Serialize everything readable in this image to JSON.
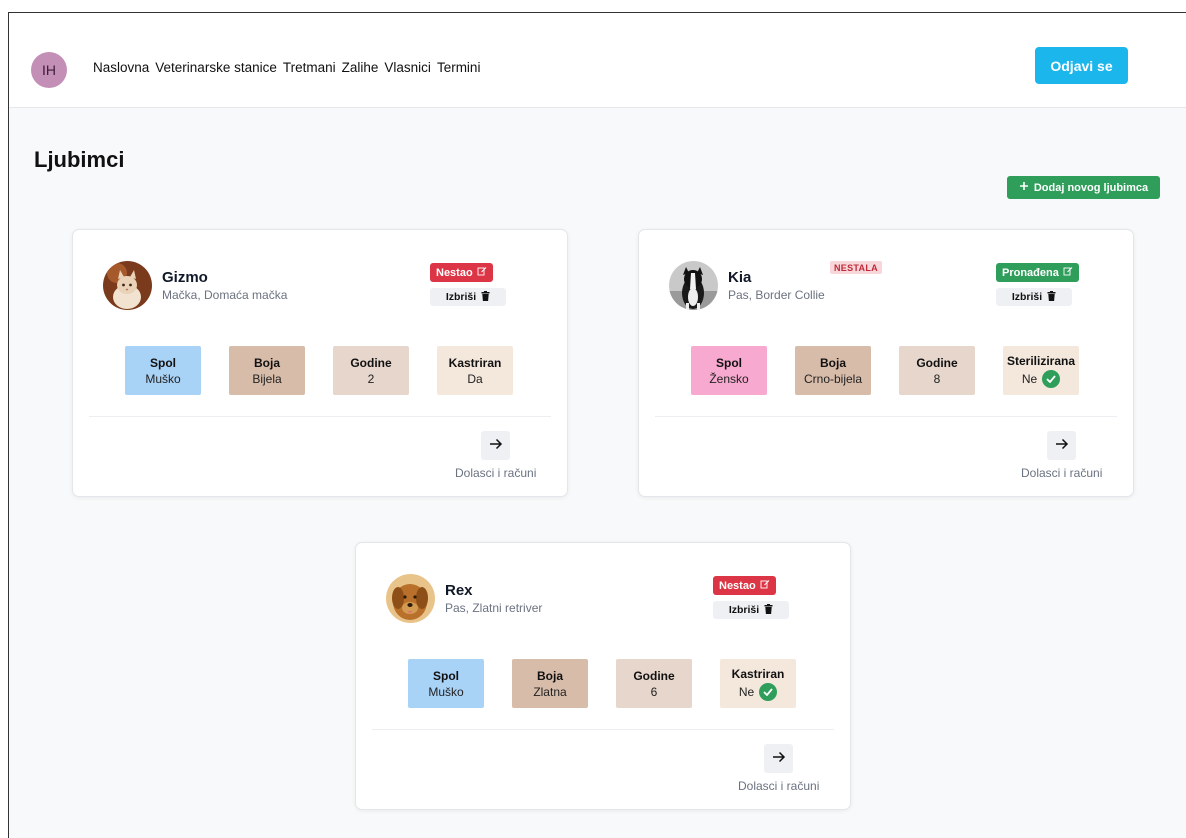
{
  "header": {
    "avatar_initials": "IH",
    "nav": [
      "Naslovna",
      "Veterinarske stanice",
      "Tretmani",
      "Zalihe",
      "Vlasnici",
      "Termini"
    ],
    "logout_label": "Odjavi se"
  },
  "page": {
    "title": "Ljubimci",
    "add_label": "Dodaj novog ljubimca"
  },
  "visits_label": "Dolasci i računi",
  "pets": [
    {
      "name": "Gizmo",
      "breed": "Mačka, Domaća mačka",
      "status_label": "Nestao",
      "delete_label": "Izbriši",
      "flag": "",
      "attrs": [
        {
          "key": "Spol",
          "value": "Muško"
        },
        {
          "key": "Boja",
          "value": "Bijela"
        },
        {
          "key": "Godine",
          "value": "2"
        },
        {
          "key": "Kastriran",
          "value": "Da"
        }
      ]
    },
    {
      "name": "Kia",
      "breed": "Pas, Border Collie",
      "status_label": "Pronađena",
      "delete_label": "Izbriši",
      "flag": "NESTALA",
      "attrs": [
        {
          "key": "Spol",
          "value": "Žensko"
        },
        {
          "key": "Boja",
          "value": "Crno-bijela"
        },
        {
          "key": "Godine",
          "value": "8"
        },
        {
          "key": "Sterilizirana",
          "value": "Ne"
        }
      ]
    },
    {
      "name": "Rex",
      "breed": "Pas, Zlatni retriver",
      "status_label": "Nestao",
      "delete_label": "Izbriši",
      "flag": "",
      "attrs": [
        {
          "key": "Spol",
          "value": "Muško"
        },
        {
          "key": "Boja",
          "value": "Zlatna"
        },
        {
          "key": "Godine",
          "value": "6"
        },
        {
          "key": "Kastriran",
          "value": "Ne"
        }
      ]
    }
  ],
  "colors": {
    "primary": "#1bb6ec",
    "success": "#2f9e5b",
    "danger": "#dc3545",
    "avatar": "#c38fb7"
  }
}
